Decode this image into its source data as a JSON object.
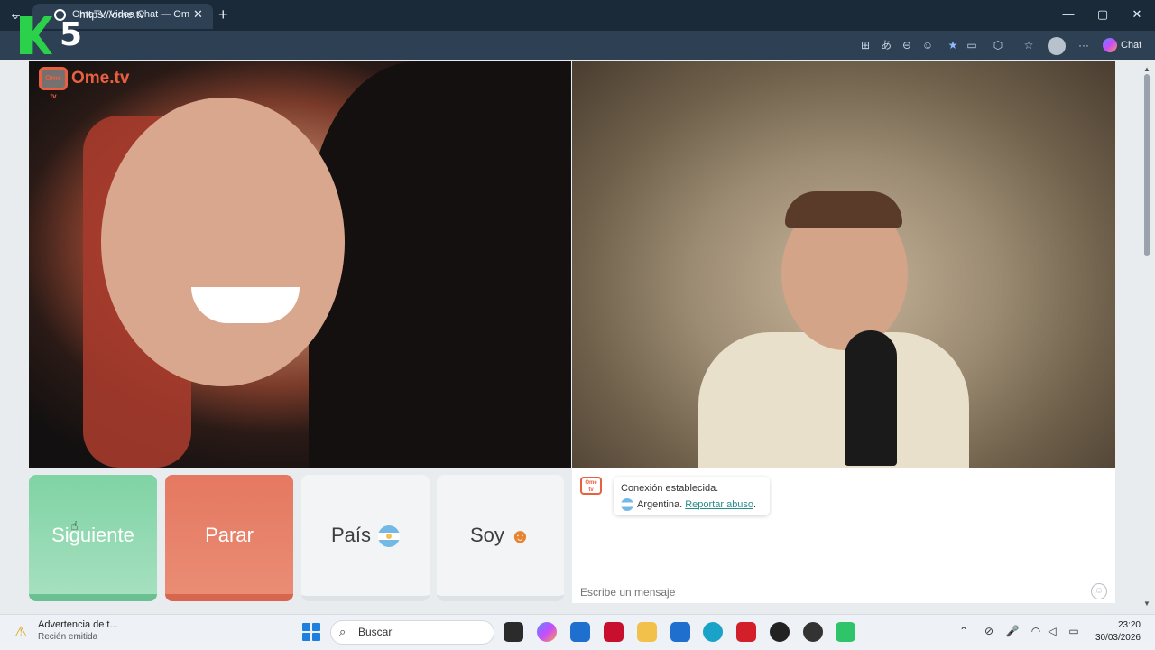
{
  "browser": {
    "tab_title": "OmeTV Video Chat — Omegle",
    "url": "https://ome.tv",
    "chat_label": "Chat"
  },
  "watermark": {
    "text": "K5"
  },
  "video": {
    "logo_text": "Ome.tv",
    "logo_icon_text": "Ome tv"
  },
  "controls": {
    "next_label": "Siguiente",
    "stop_label": "Parar",
    "country_label": "País",
    "iam_label": "Soy"
  },
  "chat": {
    "status": "Conexión establecida.",
    "country": "Argentina.",
    "report_link": "Reportar abuso",
    "report_suffix": ".",
    "input_placeholder": "Escribe un mensaje"
  },
  "taskbar": {
    "notification_title": "Advertencia de t...",
    "notification_subtitle": "Recién emitida",
    "search_label": "Buscar",
    "time": "23:20",
    "date": "30/03/2026"
  },
  "colors": {
    "next_green": "#7fd3a4",
    "stop_red": "#e57860",
    "brand_orange": "#e8603f",
    "link_teal": "#2a8c8c"
  }
}
